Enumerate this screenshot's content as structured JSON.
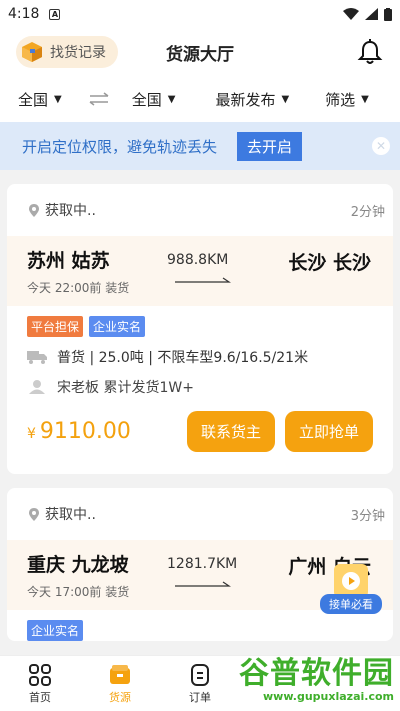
{
  "status": {
    "time": "4:18",
    "badge": "A"
  },
  "header": {
    "find_label": "找货记录",
    "title": "货源大厅"
  },
  "filters": {
    "from": "全国",
    "to": "全国",
    "sort": "最新发布",
    "filter": "筛选"
  },
  "banner": {
    "text": "开启定位权限，避免轨迹丢失",
    "button": "去开启"
  },
  "cards": [
    {
      "loc": "获取中..",
      "ago": "2分钟",
      "from": "苏州 姑苏",
      "when": "今天 22:00前 装货",
      "distance": "988.8KM",
      "to": "长沙 长沙",
      "tags": [
        "平台担保",
        "企业实名"
      ],
      "cargo": "普货 | 25.0吨 | 不限车型9.6/16.5/21米",
      "shipper": "宋老板  累计发货1W+",
      "currency": "¥",
      "price": "9110.00",
      "contact": "联系货主",
      "grab": "立即抢单"
    },
    {
      "loc": "获取中..",
      "ago": "3分钟",
      "from": "重庆 九龙坡",
      "when": "今天 17:00前 装货",
      "distance": "1281.7KM",
      "to": "广州 白云",
      "tags": [
        "企业实名"
      ]
    }
  ],
  "float_badge": {
    "label": "接单必看"
  },
  "tabs": [
    "首页",
    "货源",
    "订单"
  ],
  "watermark": {
    "big": "谷普软件园",
    "small": "www.gupuxlazai.com"
  },
  "colors": {
    "accent": "#f5a20f",
    "blue": "#3d7ae0"
  }
}
